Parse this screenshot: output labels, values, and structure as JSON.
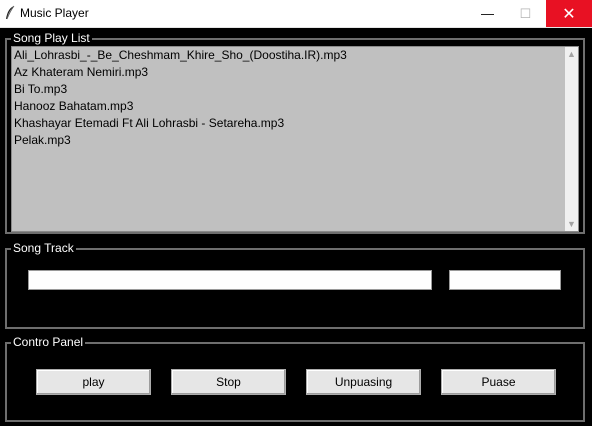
{
  "window": {
    "title": "Music Player",
    "minimize_glyph": "—",
    "maximize_glyph": "☐",
    "close_glyph": "✕"
  },
  "playlist": {
    "label": "Song Play List",
    "songs": [
      "Ali_Lohrasbi_-_Be_Cheshmam_Khire_Sho_(Doostiha.IR).mp3",
      "Az Khateram Nemiri.mp3",
      "Bi To.mp3",
      "Hanooz Bahatam.mp3",
      "Khashayar Etemadi Ft Ali Lohrasbi - Setareha.mp3",
      "Pelak.mp3"
    ]
  },
  "track": {
    "label": "Song Track",
    "name_value": "",
    "status_value": ""
  },
  "control": {
    "label": "Contro Panel",
    "play_label": "play",
    "stop_label": "Stop",
    "unpause_label": "Unpuasing",
    "pause_label": "Puase"
  },
  "colors": {
    "background": "#000000",
    "listbox_bg": "#c0c0c0",
    "close_hover": "#e81123"
  }
}
